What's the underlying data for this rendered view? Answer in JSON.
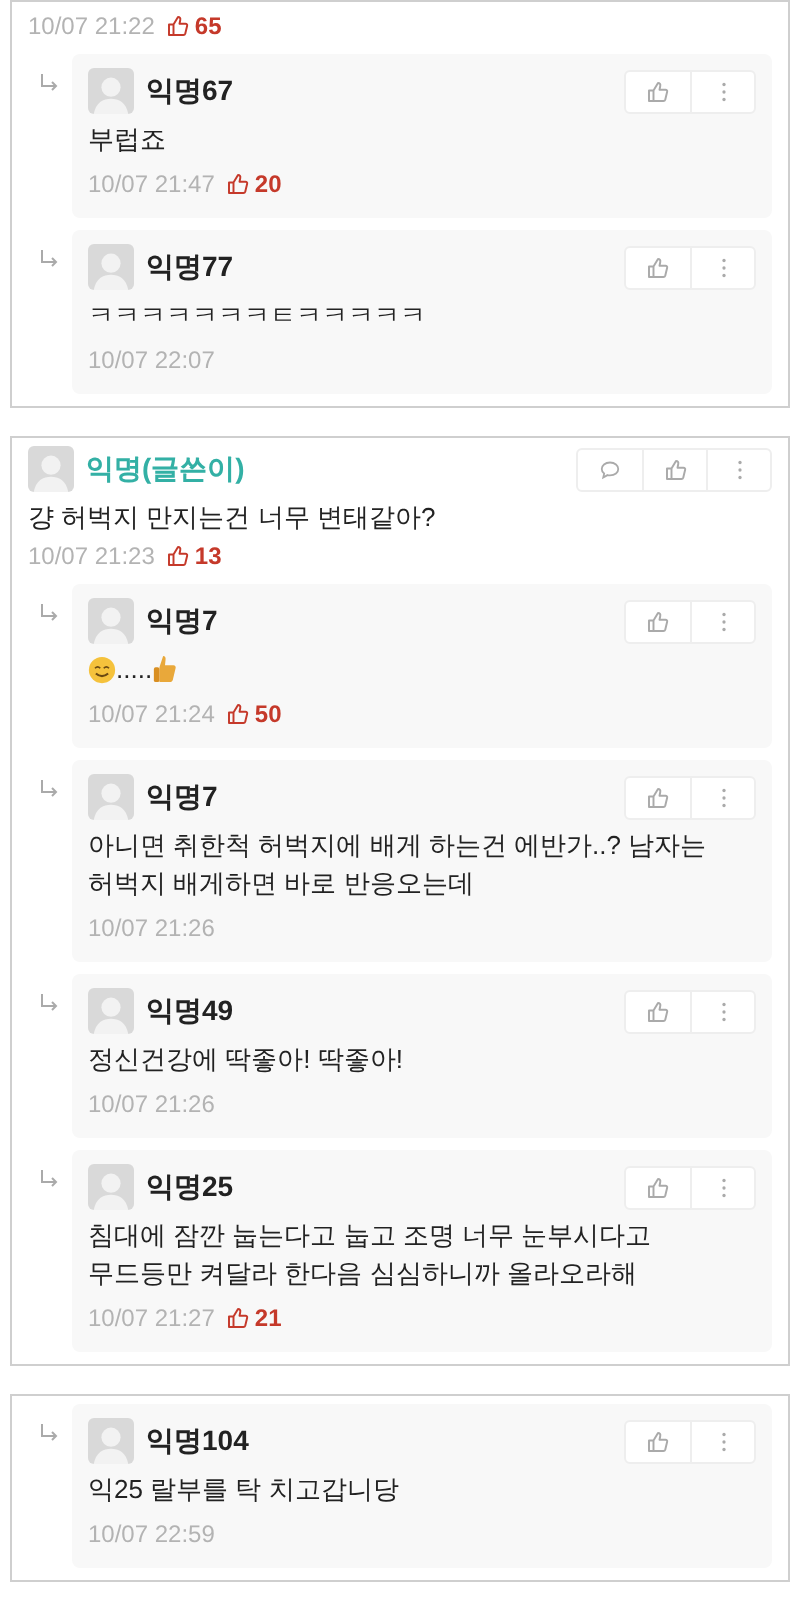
{
  "cards": [
    {
      "items": [
        {
          "kind": "footer",
          "time": "10/07 21:22",
          "likes": "65"
        },
        {
          "kind": "reply",
          "author": "익명67",
          "is_writer": false,
          "body": [
            {
              "kind": "text",
              "text": "부럽죠"
            }
          ],
          "time": "10/07 21:47",
          "likes": "20"
        },
        {
          "kind": "reply",
          "author": "익명77",
          "is_writer": false,
          "body": [
            {
              "kind": "text",
              "text": "ㅋㅋㅋㅋㅋㅋㅋㅌㅋㅋㅋㅋㅋ"
            }
          ],
          "time": "10/07 22:07"
        }
      ]
    },
    {
      "items": [
        {
          "kind": "comment",
          "author": "익명(글쓴이)",
          "is_writer": true,
          "body": [
            {
              "kind": "text",
              "text": "걍 허벅지 만지는건 너무 변태같아?"
            }
          ],
          "time": "10/07 21:23",
          "likes": "13"
        },
        {
          "kind": "reply",
          "author": "익명7",
          "is_writer": false,
          "body": [
            {
              "kind": "smiley"
            },
            {
              "kind": "text",
              "text": "....."
            },
            {
              "kind": "thumbs_up"
            }
          ],
          "time": "10/07 21:24",
          "likes": "50"
        },
        {
          "kind": "reply",
          "author": "익명7",
          "is_writer": false,
          "body": [
            {
              "kind": "text",
              "text": "아니면 취한척 허벅지에 배게 하는건 에반가..? 남자는 허벅지 배게하면 바로 반응오는데"
            }
          ],
          "time": "10/07 21:26"
        },
        {
          "kind": "reply",
          "author": "익명49",
          "is_writer": false,
          "body": [
            {
              "kind": "text",
              "text": "정신건강에 딱좋아! 딱좋아!"
            }
          ],
          "time": "10/07 21:26"
        },
        {
          "kind": "reply",
          "author": "익명25",
          "is_writer": false,
          "body": [
            {
              "kind": "text",
              "text": "침대에 잠깐 눕는다고 눕고 조명 너무 눈부시다고 무드등만 켜달라 한다음 심심하니까 올라오라해"
            }
          ],
          "time": "10/07 21:27",
          "likes": "21"
        }
      ]
    },
    {
      "items": [
        {
          "kind": "reply",
          "author": "익명104",
          "is_writer": false,
          "body": [
            {
              "kind": "text",
              "text": "익25 랄부를 탁 치고갑니당"
            }
          ],
          "time": "10/07 22:59"
        }
      ]
    }
  ]
}
